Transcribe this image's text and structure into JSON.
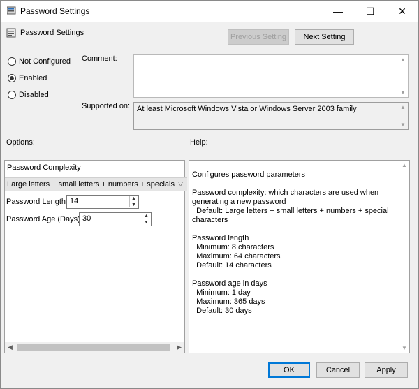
{
  "window": {
    "title": "Password Settings",
    "minimize_glyph": "—",
    "maximize_glyph": "☐",
    "close_glyph": "✕"
  },
  "header": {
    "setting_name": "Password Settings",
    "previous_label": "Previous Setting",
    "next_label": "Next Setting"
  },
  "state": {
    "options": [
      {
        "label": "Not Configured",
        "checked": false
      },
      {
        "label": "Enabled",
        "checked": true
      },
      {
        "label": "Disabled",
        "checked": false
      }
    ]
  },
  "comment": {
    "label": "Comment:",
    "value": ""
  },
  "supported": {
    "label": "Supported on:",
    "value": "At least Microsoft Windows Vista or Windows Server 2003 family"
  },
  "options_panel": {
    "label": "Options:",
    "complexity_label": "Password Complexity",
    "complexity_value": "Large letters + small letters + numbers + specials",
    "length_label": "Password Length",
    "length_value": "14",
    "age_label": "Password Age (Days)",
    "age_value": "30"
  },
  "help_panel": {
    "label": "Help:",
    "text": "Configures password parameters\n\nPassword complexity: which characters are used when generating a new password\n  Default: Large letters + small letters + numbers + special characters\n\nPassword length\n  Minimum: 8 characters\n  Maximum: 64 characters\n  Default: 14 characters\n\nPassword age in days\n  Minimum: 1 day\n  Maximum: 365 days\n  Default: 30 days"
  },
  "footer": {
    "ok_label": "OK",
    "cancel_label": "Cancel",
    "apply_label": "Apply"
  }
}
